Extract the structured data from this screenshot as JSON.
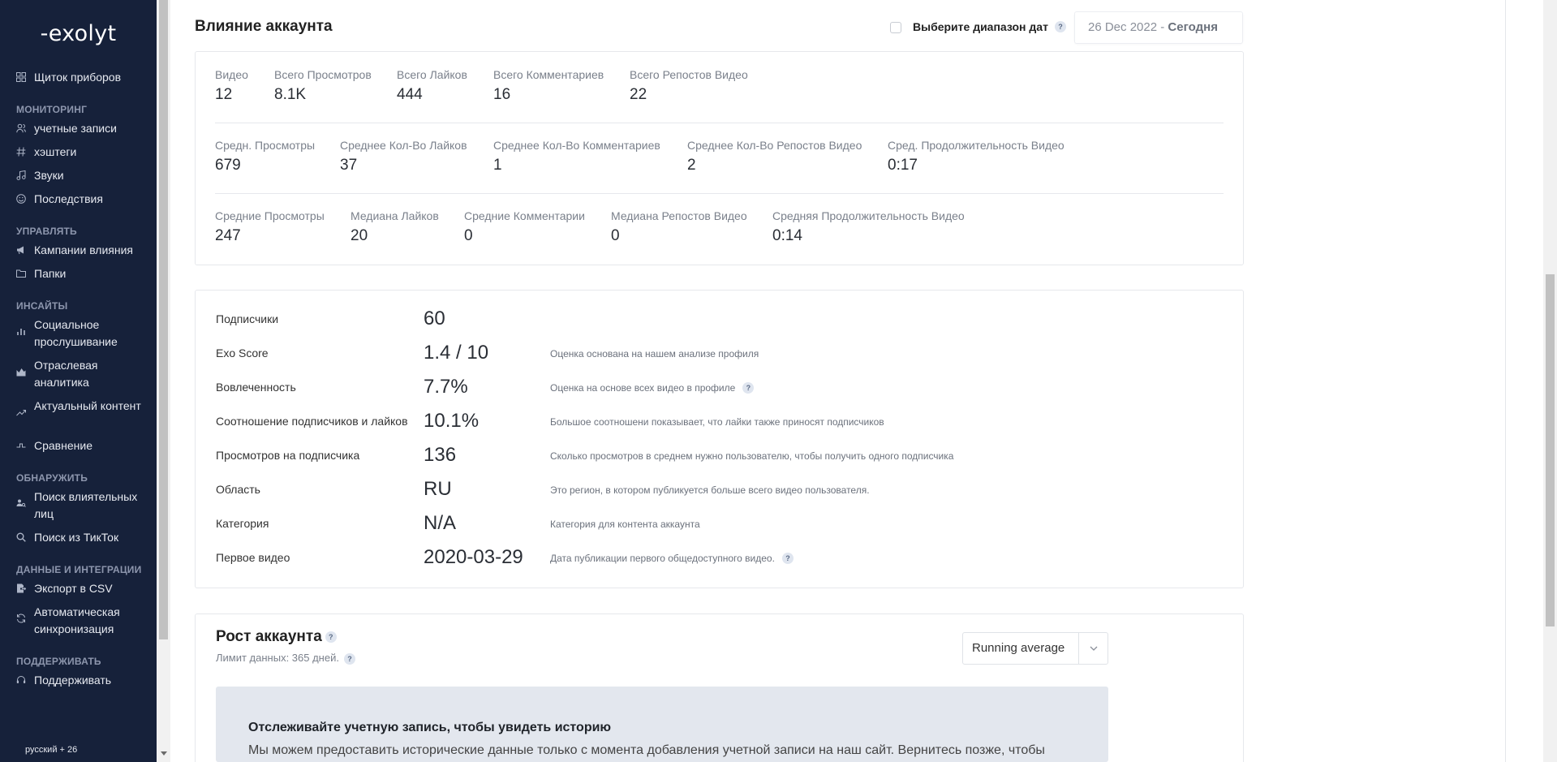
{
  "sidebar": {
    "logo": "exolyt",
    "items": {
      "dashboard": "Щиток приборов",
      "accounts": "учетные записи",
      "hashtags": "хэштеги",
      "sounds": "Звуки",
      "followers": "Последствия",
      "campaigns": "Кампании влияния",
      "folders": "Папки",
      "social_listening": "Социальное прослушивание",
      "industry": "Отраслевая аналитика",
      "trending": "Актуальный контент",
      "compare": "Сравнение",
      "influencer_search": "Поиск влиятельных лиц",
      "tiktok_search": "Поиск из ТикТок",
      "csv_export": "Экспорт в CSV",
      "autosync": "Автоматическая синхронизация",
      "support": "Поддерживать"
    },
    "sections": {
      "monitoring": "МОНИТОРИНГ",
      "manage": "УПРАВЛЯТЬ",
      "insights": "ИНСАЙТЫ",
      "discover": "ОБНАРУЖИТЬ",
      "data": "ДАННЫЕ И ИНТЕГРАЦИИ",
      "support": "ПОДДЕРЖИВАТЬ"
    },
    "language": "русский + 26"
  },
  "header": {
    "title": "Влияние аккаунта",
    "date_range_label": "Выберите диапазон дат",
    "help": "?",
    "date_from": "26 Dec 2022",
    "date_sep": " - ",
    "date_to": "Сегодня"
  },
  "stats": {
    "row1": [
      {
        "label": "Видео",
        "value": "12"
      },
      {
        "label": "Всего Просмотров",
        "value": "8.1K"
      },
      {
        "label": "Всего Лайков",
        "value": "444"
      },
      {
        "label": "Всего Комментариев",
        "value": "16"
      },
      {
        "label": "Всего Репостов Видео",
        "value": "22"
      }
    ],
    "row2": [
      {
        "label": "Средн. Просмотры",
        "value": "679"
      },
      {
        "label": "Среднее Кол-Во Лайков",
        "value": "37"
      },
      {
        "label": "Среднее Кол-Во Комментариев",
        "value": "1"
      },
      {
        "label": "Среднее Кол-Во Репостов Видео",
        "value": "2"
      },
      {
        "label": "Сред. Продолжительность Видео",
        "value": "0:17"
      }
    ],
    "row3": [
      {
        "label": "Средние Просмотры",
        "value": "247"
      },
      {
        "label": "Медиана Лайков",
        "value": "20"
      },
      {
        "label": "Средние Комментарии",
        "value": "0"
      },
      {
        "label": "Медиана Репостов Видео",
        "value": "0"
      },
      {
        "label": "Средняя Продолжительность Видео",
        "value": "0:14"
      }
    ]
  },
  "profile": [
    {
      "label": "Подписчики",
      "value": "60",
      "desc": ""
    },
    {
      "label": "Exo Score",
      "value": "1.4 / 10",
      "desc": "Оценка основана на нашем анализе профиля"
    },
    {
      "label": "Вовлеченность",
      "value": "7.7%",
      "desc": "Оценка на основе всех видео в профиле"
    },
    {
      "label": "Соотношение подписчиков и лайков",
      "value": "10.1%",
      "desc": "Большое соотношени показывает, что лайки также приносят подписчиков"
    },
    {
      "label": "Просмотров на подписчика",
      "value": "136",
      "desc": "Сколько просмотров в среднем нужно пользователю, чтобы получить одного подписчика"
    },
    {
      "label": "Область",
      "value": "RU",
      "desc": "Это регион, в котором публикуется больше всего видео пользователя."
    },
    {
      "label": "Категория",
      "value": "N/A",
      "desc": "Категория для контента аккаунта"
    },
    {
      "label": "Первое видео",
      "value": "2020-03-29",
      "desc": "Дата публикации первого общедоступного видео."
    }
  ],
  "growth": {
    "title": "Рост аккаунта",
    "subtitle": "Лимит данных: 365 дней.",
    "select_value": "Running average",
    "banner_title": "Отслеживайте учетную запись, чтобы увидеть историю",
    "banner_text": "Мы можем предоставить исторические данные только с момента добавления учетной записи на наш сайт. Вернитесь позже, чтобы"
  },
  "colors": {
    "sidebar_bg": "#16213a",
    "sidebar_section": "#8d96ad",
    "banner_bg": "#e3e7ee"
  },
  "icons": {
    "dashboard": "grid-icon",
    "accounts": "users-icon",
    "hashtags": "hashtag-icon",
    "sounds": "music-icon",
    "followers": "smile-icon",
    "campaigns": "megaphone-icon",
    "folders": "folder-icon",
    "social_listening": "bar-chart-icon",
    "industry": "area-chart-icon",
    "trending": "trend-icon",
    "compare": "compare-icon",
    "influencer_search": "people-search-icon",
    "tiktok_search": "search-icon",
    "csv_export": "export-icon",
    "autosync": "sync-icon",
    "support": "headset-icon"
  }
}
